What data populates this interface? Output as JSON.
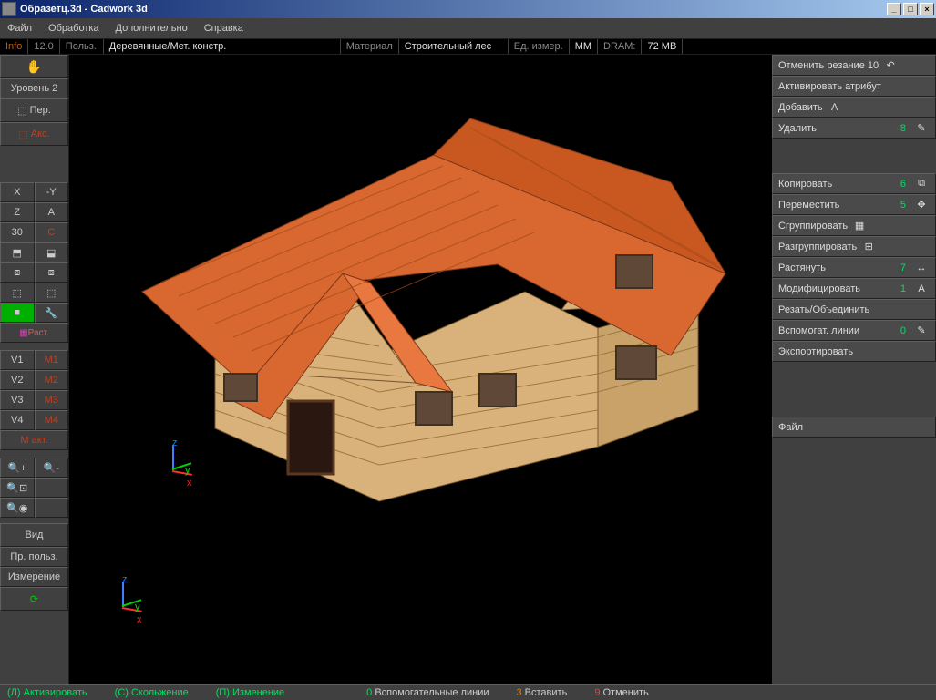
{
  "title": "Образетц.3d - Cadwork 3d",
  "menu": {
    "file": "Файл",
    "edit": "Обработка",
    "extra": "Дополнительно",
    "help": "Справка"
  },
  "infobar": {
    "info": "Info",
    "v": "12.0",
    "user": "Польз.",
    "type": "Деревянные/Мет. констр.",
    "material": "Материал",
    "matval": "Строительный лес",
    "unitlbl": "Ед. измер.",
    "unit": "MM",
    "ramlbl": "DRAM:",
    "ram": "72 MB"
  },
  "left": {
    "level": "Уровень 2",
    "per": "Пер.",
    "akco": "Акс.",
    "x": "X",
    "ny": "-Y",
    "z": "Z",
    "a": "A",
    "n30": "30",
    "c": "C",
    "rast": "Раст.",
    "v1": "V1",
    "v2": "V2",
    "v3": "V3",
    "v4": "V4",
    "m1": "М1",
    "m2": "М2",
    "m3": "М3",
    "m4": "М4",
    "mact": "М акт.",
    "view": "Вид",
    "userpref": "Пр. польз.",
    "measure": "Измерение"
  },
  "right": {
    "undo": "Отменить резание 10",
    "activateattr": "Активировать атрибут",
    "add": "Добавить",
    "delete": "Удалить",
    "delete_n": "8",
    "copy": "Копировать",
    "copy_n": "6",
    "move": "Переместить",
    "move_n": "5",
    "group": "Сгруппировать",
    "ungroup": "Разгруппировать",
    "stretch": "Растянуть",
    "stretch_n": "7",
    "modify": "Модифицировать",
    "modify_n": "1",
    "cut": "Резать/Объединить",
    "aux": "Вспомогат. линии",
    "aux_n": "0",
    "export": "Экспортировать",
    "file": "Файл"
  },
  "status": {
    "l": "(Л) Активировать",
    "c": "(С) Скольжение",
    "p": "(П) Изменение",
    "aux0": "0",
    "auxlbl": "Вспомогательные линии",
    "ins3": "3",
    "inslbl": "Вставить",
    "can9": "9",
    "canlbl": "Отменить"
  }
}
